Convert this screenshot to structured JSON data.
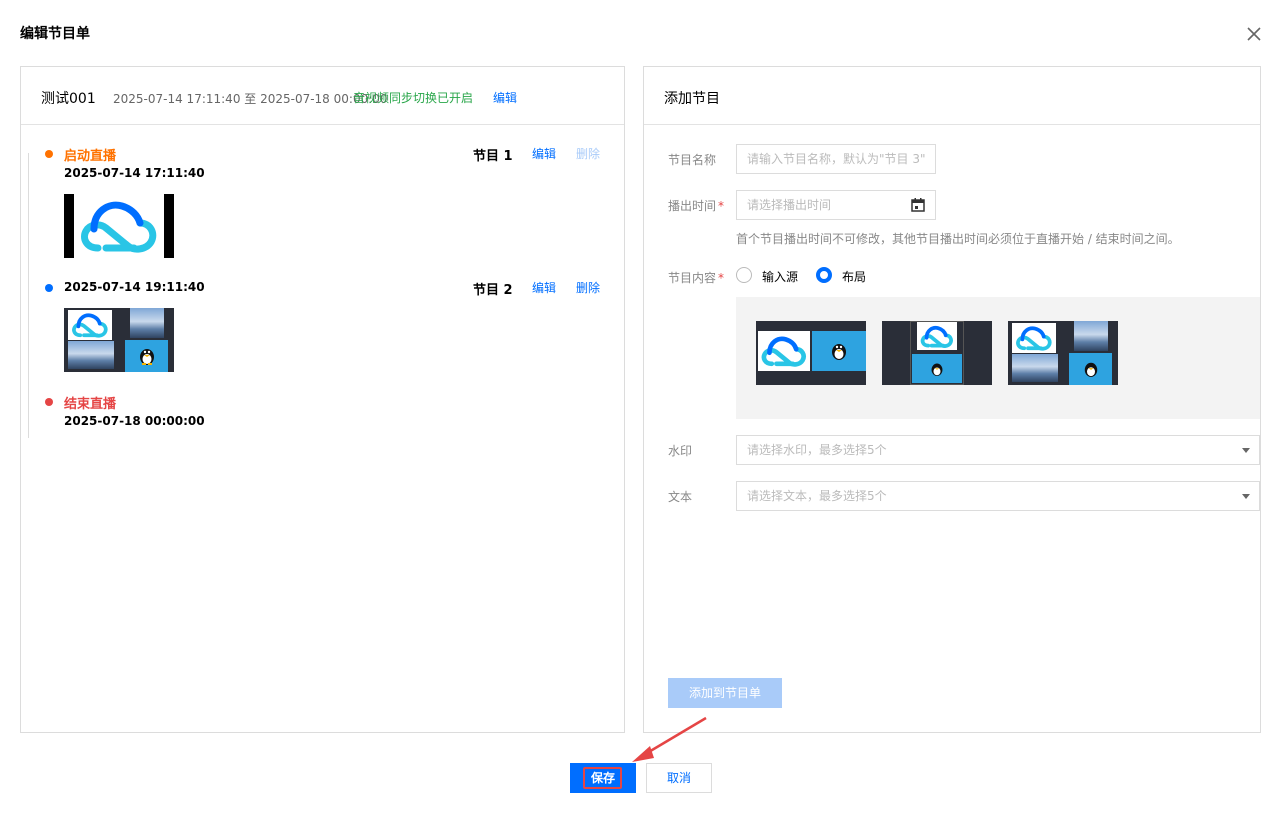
{
  "dialog": {
    "title": "编辑节目单"
  },
  "left_panel": {
    "name": "测试001",
    "time_range": "2025-07-14 17:11:40 至 2025-07-18 00:00:00",
    "sync_status": "音视频同步切换已开启",
    "edit_label": "编辑",
    "timeline": {
      "start_label": "启动直播",
      "start_time": "2025-07-14 17:11:40",
      "end_label": "结束直播",
      "end_time": "2025-07-18 00:00:00",
      "programs": [
        {
          "name": "节目 1",
          "time": "2025-07-14 17:11:40",
          "edit": "编辑",
          "delete": "删除"
        },
        {
          "name": "节目 2",
          "time": "2025-07-14 19:11:40",
          "edit": "编辑",
          "delete": "删除"
        }
      ]
    }
  },
  "right_panel": {
    "title": "添加节目",
    "form": {
      "name_label": "节目名称",
      "name_placeholder": "请输入节目名称，默认为\"节目 3\"",
      "time_label": "播出时间",
      "time_placeholder": "请选择播出时间",
      "time_hint": "首个节目播出时间不可修改，其他节目播出时间必须位于直播开始 / 结束时间之间。",
      "required_mark": "*",
      "content_label": "节目内容",
      "content_options": [
        "输入源",
        "布局"
      ],
      "content_selected": "布局",
      "watermark_label": "水印",
      "watermark_placeholder": "请选择水印，最多选择5个",
      "text_label": "文本",
      "text_placeholder": "请选择文本，最多选择5个",
      "add_button": "添加到节目单"
    }
  },
  "footer": {
    "save": "保存",
    "cancel": "取消"
  },
  "colors": {
    "primary": "#006eff",
    "start": "#ff7200",
    "end": "#e54545",
    "success": "#29a64a",
    "disabled": "#a9cbf9"
  }
}
